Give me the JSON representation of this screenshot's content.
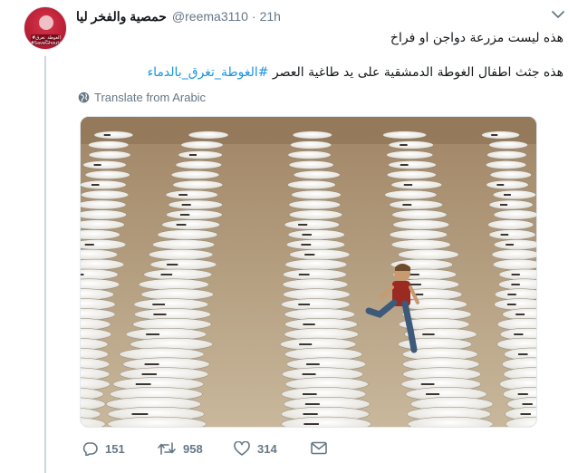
{
  "tweet": {
    "display_name": "حمصية والفخر ليا",
    "handle": "@reema3110",
    "separator": "·",
    "time": "21h",
    "text_line1": "هذه ليست مزرعة دواجن او فراخ",
    "text_line2_prefix": "هذه جثث اطفال الغوطة الدمشقية على يد طاغية العصر ",
    "hashtag": "#الغوطة_تغرق_بالدماء",
    "translate_label": "Translate from Arabic"
  },
  "avatar": {
    "line1": "#الغوطة_تغرق",
    "line2": "#SaveGhouta"
  },
  "actions": {
    "replies": "151",
    "retweets": "958",
    "likes": "314"
  },
  "colors": {
    "link": "#1b95e0",
    "muted": "#657786",
    "thread": "#ccd6dd"
  },
  "icons": [
    "chevron-down-icon",
    "globe-icon",
    "reply-icon",
    "retweet-icon",
    "like-icon",
    "direct-message-icon"
  ]
}
